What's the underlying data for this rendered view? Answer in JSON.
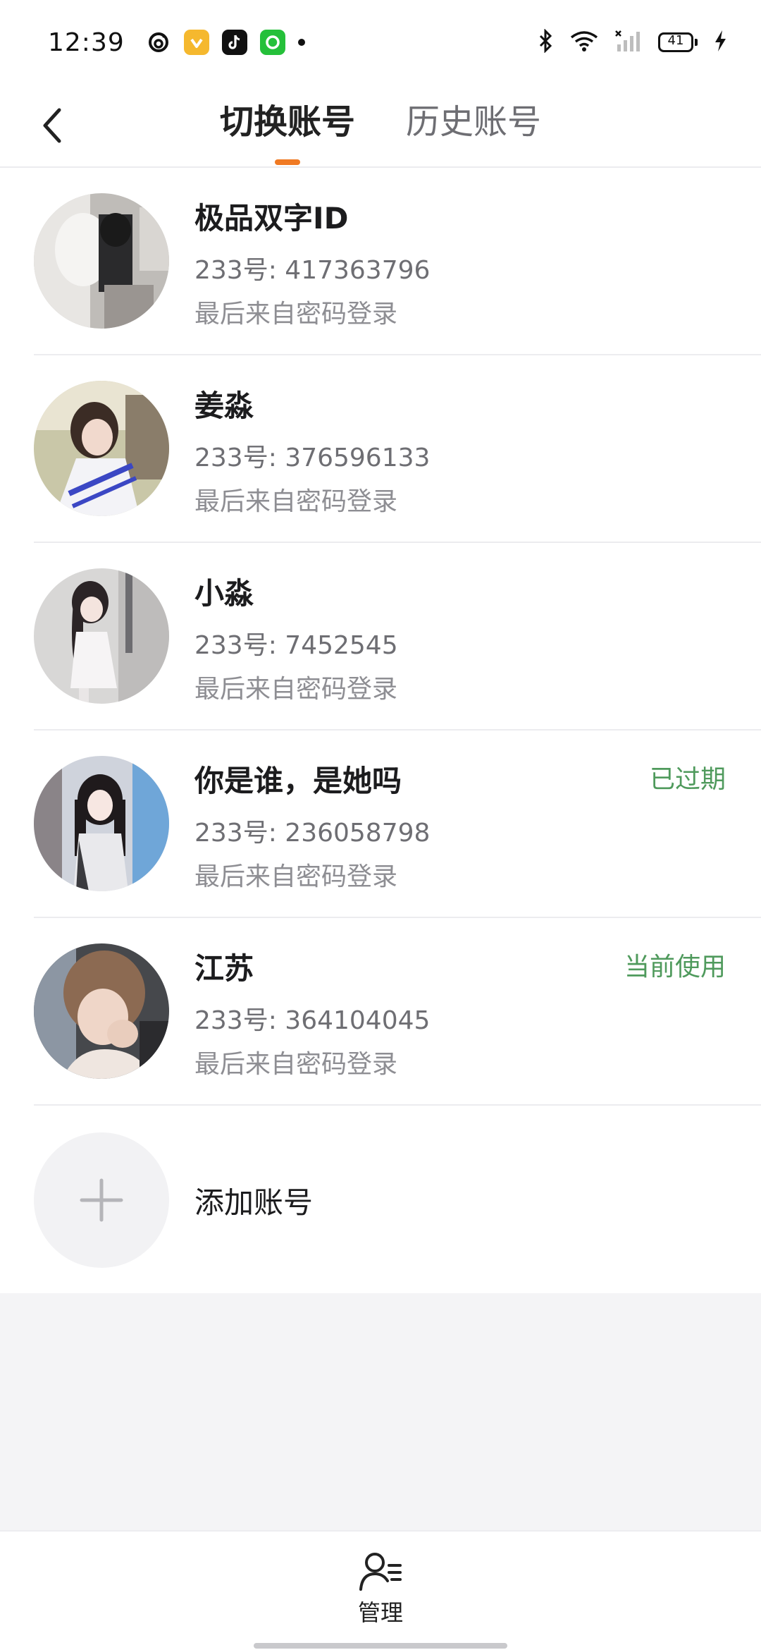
{
  "status_bar": {
    "time": "12:39",
    "battery": "41",
    "app_icons": [
      "netease-music-icon",
      "app-yellow-icon",
      "tiktok-icon",
      "app-green-icon",
      "notification-dot-icon"
    ],
    "right_icons": [
      "bluetooth-icon",
      "wifi-icon",
      "signal-icon",
      "battery-icon",
      "charging-icon"
    ]
  },
  "header": {
    "back_icon": "back-arrow-icon",
    "tabs": [
      {
        "label": "切换账号",
        "active": true
      },
      {
        "label": "历史账号",
        "active": false
      }
    ],
    "indicator_color": "#f07a23"
  },
  "accounts": [
    {
      "name": "极品双字ID",
      "id": "233号: 417363796",
      "login": "最后来自密码登录",
      "status": ""
    },
    {
      "name": "姜淼",
      "id": "233号: 376596133",
      "login": "最后来自密码登录",
      "status": ""
    },
    {
      "name": "小淼",
      "id": "233号: 7452545",
      "login": "最后来自密码登录",
      "status": ""
    },
    {
      "name": "你是谁，是她吗",
      "id": "233号: 236058798",
      "login": "最后来自密码登录",
      "status": "已过期"
    },
    {
      "name": "江苏",
      "id": "233号: 364104045",
      "login": "最后来自密码登录",
      "status": "当前使用"
    }
  ],
  "add_account": {
    "label": "添加账号",
    "icon": "plus-icon"
  },
  "bottom_bar": {
    "manage_label": "管理",
    "manage_icon": "user-manage-icon"
  },
  "colors": {
    "status_text": "#4f9a5c",
    "accent": "#f07a23"
  }
}
